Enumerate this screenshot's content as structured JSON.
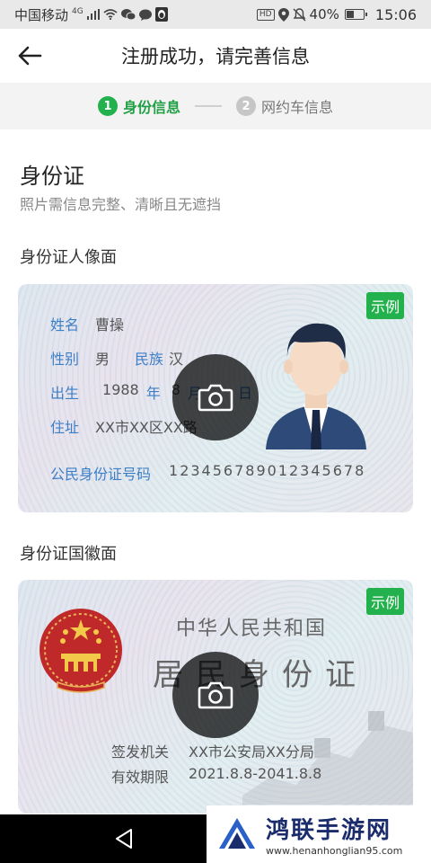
{
  "status_bar": {
    "carrier": "中国移动",
    "network": "4G",
    "battery": "40%",
    "battery_level": 0.4,
    "time": "15:06",
    "hd_label": "HD",
    "icons": [
      "signal-icon",
      "wifi-icon",
      "wechat-icon",
      "message-icon",
      "qq-icon",
      "location-icon",
      "mute-icon",
      "battery-icon"
    ]
  },
  "header": {
    "back_icon": "arrow-left-icon",
    "title": "注册成功，请完善信息"
  },
  "steps": [
    {
      "num": "1",
      "label": "身份信息",
      "active": true
    },
    {
      "num": "2",
      "label": "网约车信息",
      "active": false
    }
  ],
  "section": {
    "title": "身份证",
    "subtitle": "照片需信息完整、清晰且无遮挡"
  },
  "front_card": {
    "label": "身份证人像面",
    "badge": "示例",
    "name_key": "姓名",
    "name_val": "曹操",
    "sex_key": "性别",
    "sex_val": "男",
    "ethnic_key": "民族",
    "ethnic_val": "汉",
    "birth_key": "出生",
    "birth_year": "1988",
    "birth_year_unit": "年",
    "birth_month": "8",
    "birth_month_unit": "月",
    "birth_day_unit": "日",
    "addr_key": "住址",
    "addr_val": "XX市XX区XX路",
    "idnum_key": "公民身份证号码",
    "idnum_val": "123456789012345678"
  },
  "back_card": {
    "label": "身份证国徽面",
    "badge": "示例",
    "country": "中华人民共和国",
    "doc_title": "居民身份证",
    "authority_key": "签发机关",
    "authority_val": "XX市公安局XX分局",
    "validity_key": "有效期限",
    "validity_val": "2021.8.8-2041.8.8"
  },
  "watermark": {
    "title": "鸿联手游网",
    "url": "www.henanhonglian95.com"
  },
  "colors": {
    "accent_green": "#22b14c",
    "field_blue": "#3d7fc6"
  }
}
